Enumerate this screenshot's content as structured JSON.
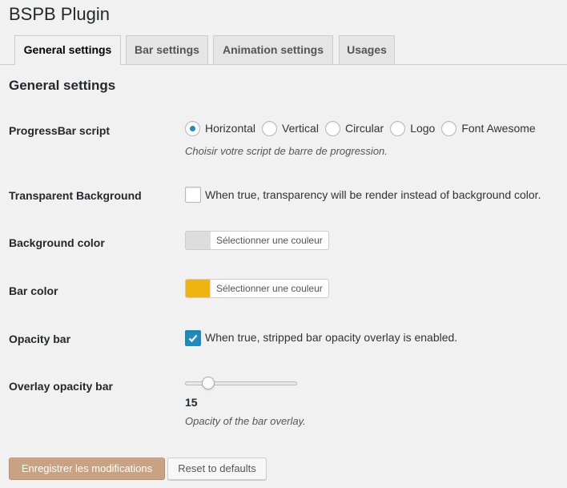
{
  "page": {
    "title": "BSPB Plugin"
  },
  "tabs": [
    {
      "label": "General settings",
      "active": true
    },
    {
      "label": "Bar settings",
      "active": false
    },
    {
      "label": "Animation settings",
      "active": false
    },
    {
      "label": "Usages",
      "active": false
    }
  ],
  "section": {
    "title": "General settings"
  },
  "progressbar_script": {
    "label": "ProgressBar script",
    "options": [
      "Horizontal",
      "Vertical",
      "Circular",
      "Logo",
      "Font Awesome"
    ],
    "selected": "Horizontal",
    "description": "Choisir votre script de barre de progression."
  },
  "transparent_background": {
    "label": "Transparent Background",
    "checked": false,
    "text": "When true, transparency will be render instead of background color."
  },
  "background_color": {
    "label": "Background color",
    "button_text": "Sélectionner une couleur",
    "color": "#dddddd"
  },
  "bar_color": {
    "label": "Bar color",
    "button_text": "Sélectionner une couleur",
    "color": "#f0b310"
  },
  "opacity_bar": {
    "label": "Opacity bar",
    "checked": true,
    "text": "When true, stripped bar opacity overlay is enabled."
  },
  "overlay_opacity_bar": {
    "label": "Overlay opacity bar",
    "value": "15",
    "description": "Opacity of the bar overlay."
  },
  "buttons": {
    "save": "Enregistrer les modifications",
    "reset": "Reset to defaults"
  },
  "colors": {
    "accent": "#1e8cbe",
    "primary_button": "#c8a283"
  },
  "icons": {
    "checkmark": "check-icon"
  }
}
